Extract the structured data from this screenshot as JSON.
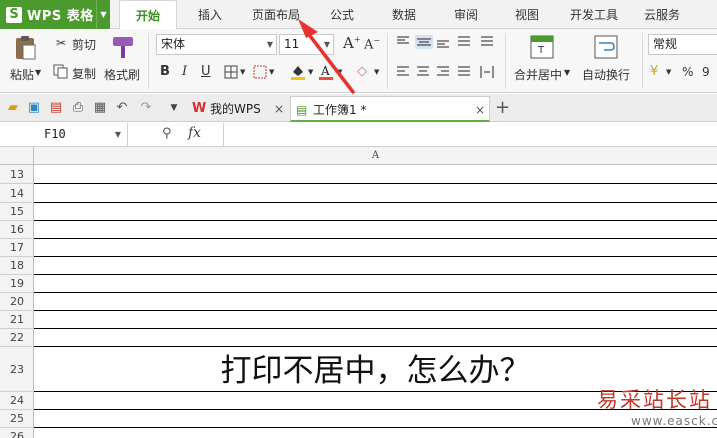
{
  "menubar": {
    "app_name": "WPS 表格",
    "app_logo": "S",
    "tabs": [
      {
        "label": "开始",
        "active": true
      },
      {
        "label": "插入"
      },
      {
        "label": "页面布局"
      },
      {
        "label": "公式"
      },
      {
        "label": "数据"
      },
      {
        "label": "审阅"
      },
      {
        "label": "视图"
      },
      {
        "label": "开发工具"
      },
      {
        "label": "云服务"
      }
    ]
  },
  "ribbon": {
    "paste_label": "粘贴",
    "cut_label": "剪切",
    "copy_label": "复制",
    "format_painter_label": "格式刷",
    "font_name": "宋体",
    "font_size": "11",
    "bold": "B",
    "italic": "I",
    "underline": "U",
    "merge_center_label": "合并居中",
    "wrap_text_label": "自动换行",
    "number_format": "常规",
    "percent": "%",
    "comma": "9"
  },
  "quickbar": {
    "doc_tabs": [
      {
        "label": "我的WPS"
      },
      {
        "label": "工作簿1 *",
        "active": true
      }
    ],
    "close_glyph": "×",
    "add_glyph": "+"
  },
  "formula_bar": {
    "name_box": "F10",
    "fx": "fx",
    "content": ""
  },
  "grid": {
    "column_header": "A",
    "rows": [
      "13",
      "14",
      "15",
      "16",
      "17",
      "18",
      "19",
      "20",
      "21",
      "22",
      "23",
      "24",
      "25",
      "26"
    ],
    "cell_a23": "打印不居中，怎么办？"
  },
  "watermark": {
    "text": "易采站长站",
    "url": "www.easck.com"
  },
  "colors": {
    "brand_green": "#4a9a2e",
    "annotation_red": "#e8322e",
    "watermark_red": "#c0392b"
  }
}
